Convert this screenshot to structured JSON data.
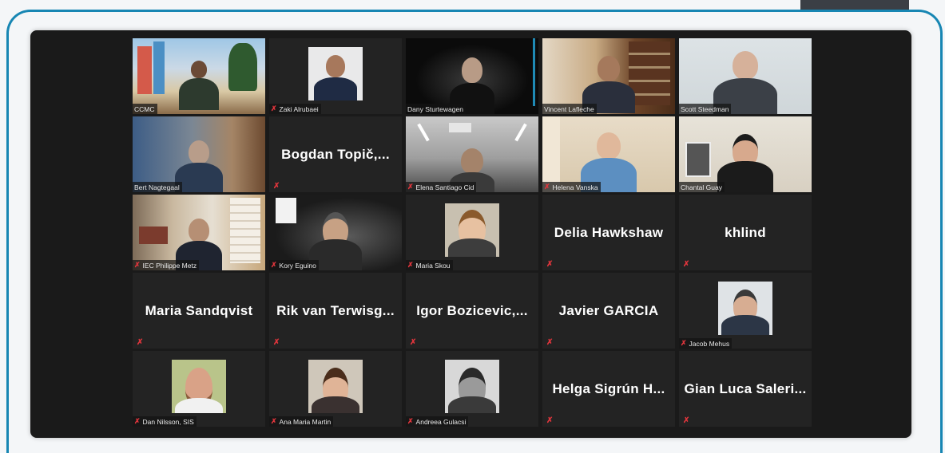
{
  "colors": {
    "frame_border": "#1786b3",
    "meeting_background": "#1a1a1a",
    "tile_background": "#232323",
    "active_speaker_outline": "#b7e36c",
    "muted_icon": "#e0353c"
  },
  "muted_icon": "mic-muted-icon",
  "participants": [
    {
      "name": "CCMC",
      "video": true,
      "muted": false
    },
    {
      "name": "Zaki Alrubaei",
      "video": true,
      "muted": true
    },
    {
      "name": "Dany Sturtewagen",
      "video": true,
      "muted": false
    },
    {
      "name": "Vincent Lafleche",
      "video": true,
      "muted": false
    },
    {
      "name": "Scott Steedman",
      "video": true,
      "muted": false
    },
    {
      "name": "Bert Nagtegaal",
      "video": true,
      "muted": false
    },
    {
      "name": "Bogdan Topič,...",
      "video": false,
      "muted": true
    },
    {
      "name": "Elena Santiago Cid",
      "video": true,
      "muted": true
    },
    {
      "name": "Helena Vanska",
      "video": true,
      "muted": true
    },
    {
      "name": "Chantal Guay",
      "video": true,
      "muted": false,
      "active_speaker": true
    },
    {
      "name": "IEC Philippe Metz",
      "video": true,
      "muted": true
    },
    {
      "name": "Kory Eguino",
      "video": true,
      "muted": true
    },
    {
      "name": "Maria Skou",
      "video": true,
      "muted": true
    },
    {
      "name": "Delia Hawkshaw",
      "video": false,
      "muted": true
    },
    {
      "name": "khlind",
      "video": false,
      "muted": true
    },
    {
      "name": "Maria Sandqvist",
      "video": false,
      "muted": true
    },
    {
      "name": "Rik van Terwisg...",
      "video": false,
      "muted": true
    },
    {
      "name": "Igor Bozicevic,...",
      "video": false,
      "muted": true
    },
    {
      "name": "Javier GARCIA",
      "video": false,
      "muted": true
    },
    {
      "name": "Jacob Mehus",
      "video": true,
      "muted": true
    },
    {
      "name": "Dan Nilsson, SIS",
      "video": true,
      "muted": true
    },
    {
      "name": "Ana Maria Martin",
      "video": true,
      "muted": true
    },
    {
      "name": "Andreea Gulacsi",
      "video": true,
      "muted": true
    },
    {
      "name": "Helga Sigrún H...",
      "video": false,
      "muted": true
    },
    {
      "name": "Gian Luca Saleri...",
      "video": false,
      "muted": true
    }
  ]
}
